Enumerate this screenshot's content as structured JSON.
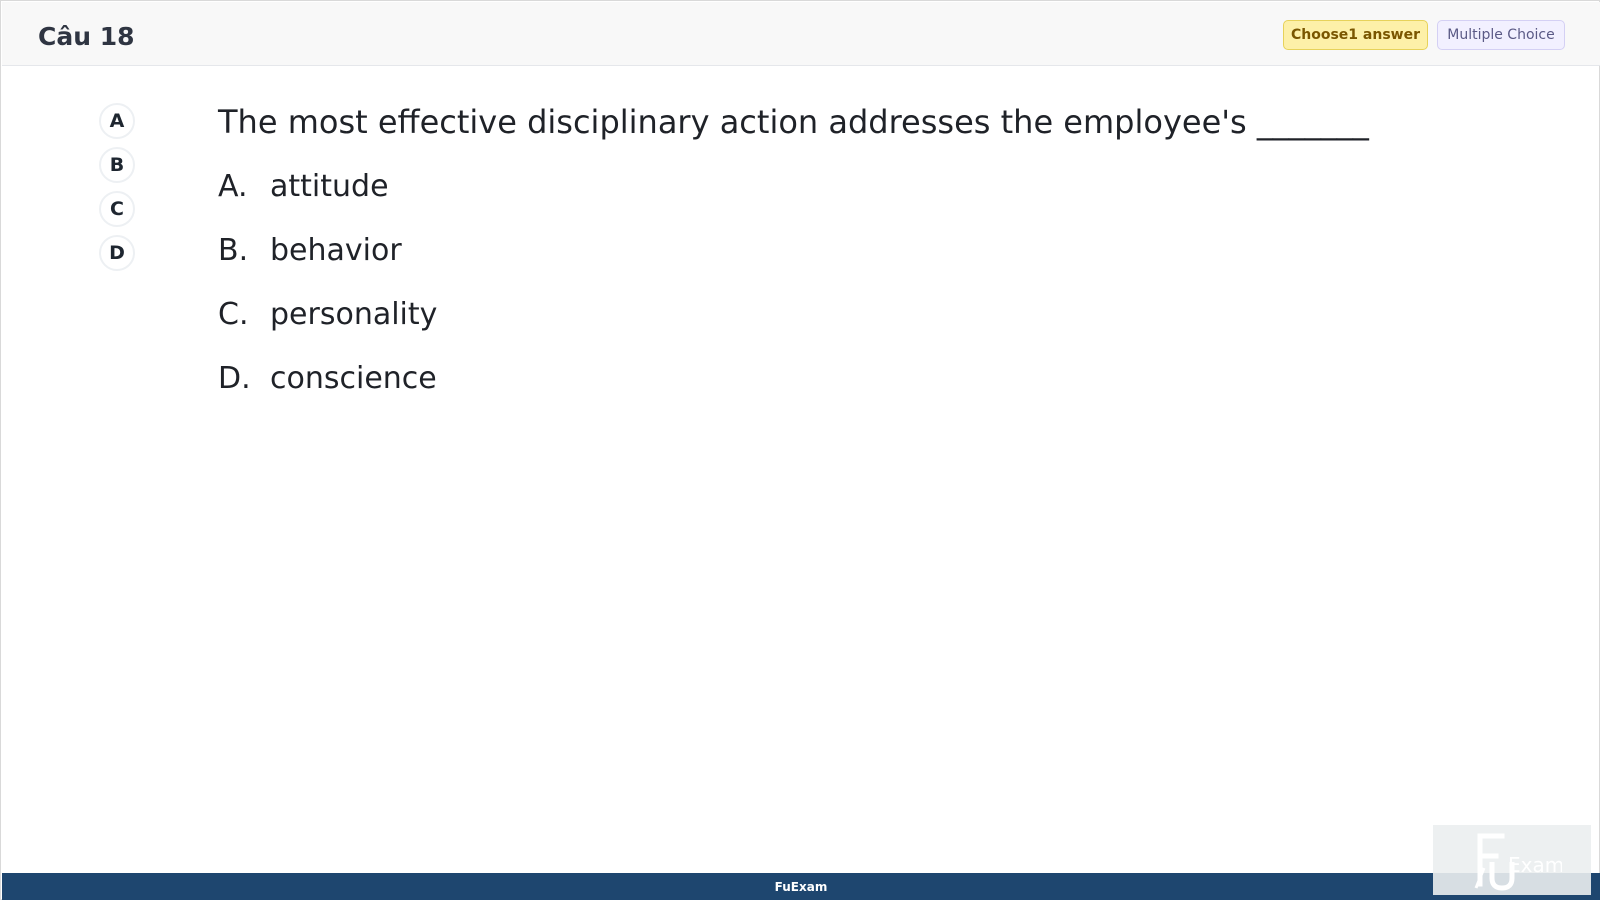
{
  "header": {
    "question_label": "Câu 18",
    "choose_badge": "Choose1 answer",
    "type_badge": "Multiple Choice"
  },
  "option_selector": [
    "A",
    "B",
    "C",
    "D"
  ],
  "question": {
    "text": "The most effective disciplinary action addresses the employee's _______"
  },
  "answers": [
    {
      "letter": "A.",
      "text": "attitude"
    },
    {
      "letter": "B.",
      "text": "behavior"
    },
    {
      "letter": "C.",
      "text": "personality"
    },
    {
      "letter": "D.",
      "text": "conscience"
    }
  ],
  "footer": {
    "brand": "FuExam"
  },
  "logo": {
    "text": "FU Exam"
  },
  "colors": {
    "header_bg": "#f8f8f8",
    "footer_bg": "#1e466f",
    "choose_badge_bg": "#fdf0a8",
    "type_badge_bg": "#f2f0ff"
  }
}
